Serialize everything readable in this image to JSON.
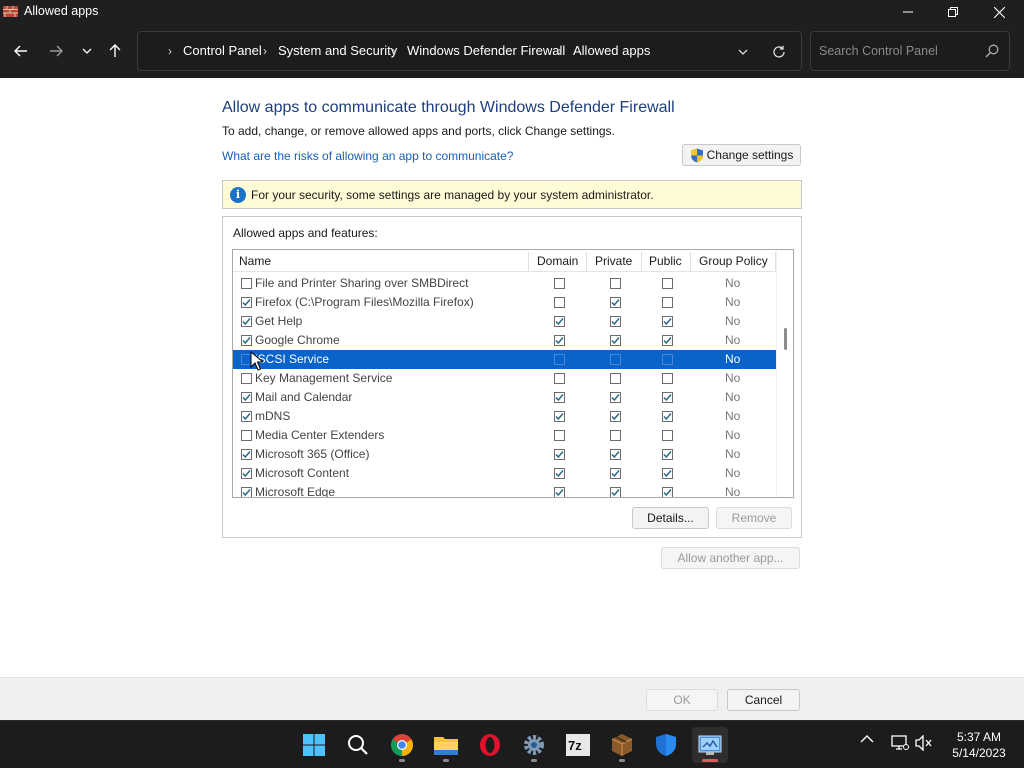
{
  "window": {
    "title": "Allowed apps"
  },
  "breadcrumbs": [
    "Control Panel",
    "System and Security",
    "Windows Defender Firewall",
    "Allowed apps"
  ],
  "search": {
    "placeholder": "Search Control Panel"
  },
  "main": {
    "heading": "Allow apps to communicate through Windows Defender Firewall",
    "subtext": "To add, change, or remove allowed apps and ports, click Change settings.",
    "risk_link": "What are the risks of allowing an app to communicate?",
    "change_settings_label": "Change settings",
    "info_text": "For your security, some settings are managed by your system administrator.",
    "group_label": "Allowed apps and features:"
  },
  "table": {
    "columns": [
      "Name",
      "Domain",
      "Private",
      "Public",
      "Group Policy"
    ],
    "rows": [
      {
        "name": "File and Printer Sharing over SMBDirect",
        "enabled": false,
        "domain": false,
        "private": false,
        "public": false,
        "group_policy": "No",
        "selected": false
      },
      {
        "name": "Firefox (C:\\Program Files\\Mozilla Firefox)",
        "enabled": true,
        "domain": false,
        "private": true,
        "public": false,
        "group_policy": "No",
        "selected": false
      },
      {
        "name": "Get Help",
        "enabled": true,
        "domain": true,
        "private": true,
        "public": true,
        "group_policy": "No",
        "selected": false
      },
      {
        "name": "Google Chrome",
        "enabled": true,
        "domain": true,
        "private": true,
        "public": true,
        "group_policy": "No",
        "selected": false
      },
      {
        "name": "iSCSI Service",
        "enabled": false,
        "domain": false,
        "private": false,
        "public": false,
        "group_policy": "No",
        "selected": true
      },
      {
        "name": "Key Management Service",
        "enabled": false,
        "domain": false,
        "private": false,
        "public": false,
        "group_policy": "No",
        "selected": false
      },
      {
        "name": "Mail and Calendar",
        "enabled": true,
        "domain": true,
        "private": true,
        "public": true,
        "group_policy": "No",
        "selected": false
      },
      {
        "name": "mDNS",
        "enabled": true,
        "domain": true,
        "private": true,
        "public": true,
        "group_policy": "No",
        "selected": false
      },
      {
        "name": "Media Center Extenders",
        "enabled": false,
        "domain": false,
        "private": false,
        "public": false,
        "group_policy": "No",
        "selected": false
      },
      {
        "name": "Microsoft 365 (Office)",
        "enabled": true,
        "domain": true,
        "private": true,
        "public": true,
        "group_policy": "No",
        "selected": false
      },
      {
        "name": "Microsoft Content",
        "enabled": true,
        "domain": true,
        "private": true,
        "public": true,
        "group_policy": "No",
        "selected": false
      },
      {
        "name": "Microsoft Edge",
        "enabled": true,
        "domain": true,
        "private": true,
        "public": true,
        "group_policy": "No",
        "selected": false
      }
    ]
  },
  "buttons": {
    "details": "Details...",
    "remove": "Remove",
    "allow_another": "Allow another app...",
    "ok": "OK",
    "cancel": "Cancel"
  },
  "taskbar": {
    "apps": [
      "start-icon",
      "search-icon",
      "chrome-icon",
      "file-explorer-icon",
      "opera-icon",
      "settings-icon",
      "7zip-icon",
      "archive-icon",
      "windows-security-icon",
      "control-panel-icon"
    ],
    "time": "5:37 AM",
    "date": "5/14/2023"
  },
  "colors": {
    "heading": "#1e3f7c",
    "link": "#1a5fb4",
    "selection": "#0a63c9",
    "info_bar": "#fffbd6"
  }
}
